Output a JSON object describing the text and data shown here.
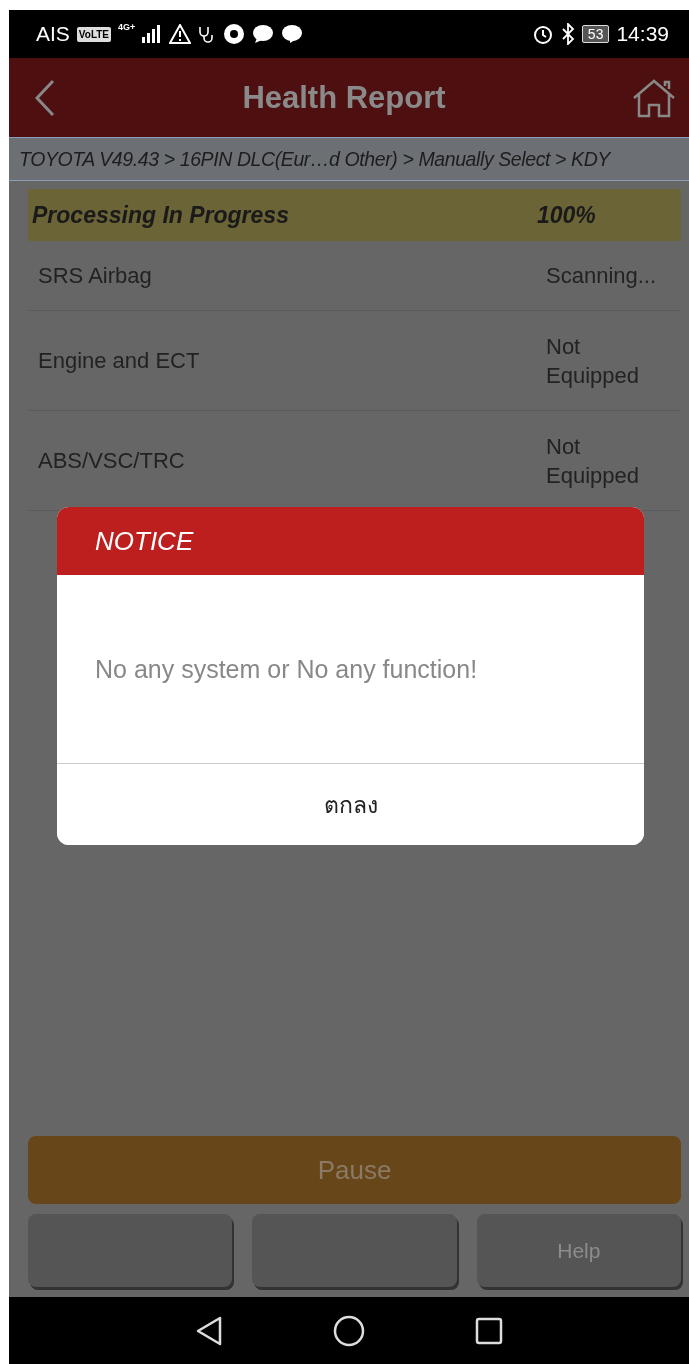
{
  "status_bar": {
    "carrier": "AIS",
    "volte": "VoLTE",
    "network": "4G+",
    "battery": "53",
    "time": "14:39"
  },
  "header": {
    "title": "Health Report"
  },
  "breadcrumb": "TOYOTA V49.43 > 16PIN DLC(Eur…d Other) > Manually Select > KDY",
  "progress": {
    "label": "Processing In Progress",
    "percent": "100%"
  },
  "systems": [
    {
      "name": "SRS Airbag",
      "status": "Scanning..."
    },
    {
      "name": "Engine and ECT",
      "status": "Not Equipped"
    },
    {
      "name": "ABS/VSC/TRC",
      "status": "Not Equipped"
    }
  ],
  "dialog": {
    "title": "NOTICE",
    "message": "No any system or No any function!",
    "button": "ตกลง"
  },
  "pause_button": "Pause",
  "bottom_buttons": [
    {
      "kind": "blank"
    },
    {
      "kind": "blank"
    },
    {
      "kind": "text",
      "label": "Help"
    }
  ]
}
